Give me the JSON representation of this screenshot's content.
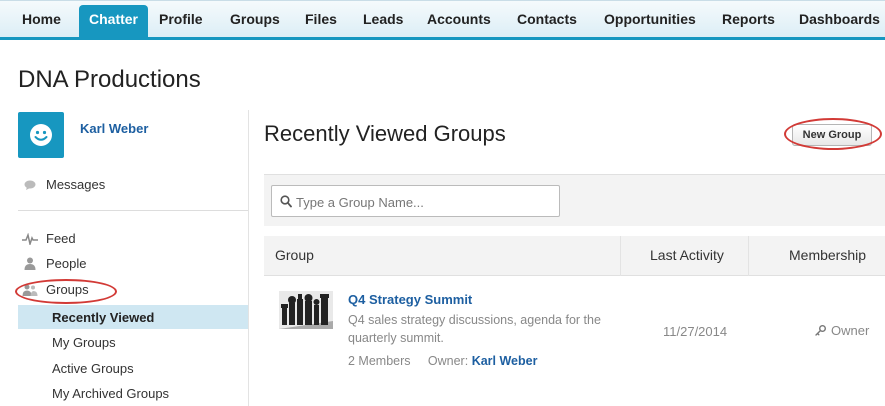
{
  "nav": {
    "tabs": [
      {
        "label": "Home"
      },
      {
        "label": "Chatter",
        "active": true
      },
      {
        "label": "Profile"
      },
      {
        "label": "Groups"
      },
      {
        "label": "Files"
      },
      {
        "label": "Leads"
      },
      {
        "label": "Accounts"
      },
      {
        "label": "Contacts"
      },
      {
        "label": "Opportunities"
      },
      {
        "label": "Reports"
      },
      {
        "label": "Dashboards"
      }
    ]
  },
  "org": {
    "title": "DNA Productions"
  },
  "sidebar": {
    "user_name": "Karl Weber",
    "messages_label": "Messages",
    "feed_label": "Feed",
    "people_label": "People",
    "groups_label": "Groups",
    "group_links": [
      {
        "label": "Recently Viewed",
        "active": true
      },
      {
        "label": "My Groups"
      },
      {
        "label": "Active Groups"
      },
      {
        "label": "My Archived Groups"
      }
    ]
  },
  "main": {
    "title": "Recently Viewed Groups",
    "new_group_label": "New Group",
    "search_placeholder": "Type a Group Name...",
    "columns": [
      "Group",
      "Last Activity",
      "Membership"
    ],
    "rows": [
      {
        "name": "Q4 Strategy Summit",
        "description": "Q4 sales strategy discussions, agenda for the quarterly summit.",
        "members": "2 Members",
        "owner_label": "Owner:",
        "owner_name": "Karl Weber",
        "last_activity": "11/27/2014",
        "membership": "Owner"
      }
    ]
  },
  "colors": {
    "brand": "#1797c0",
    "link": "#1d5fa1",
    "annotation": "#d23a36",
    "active_row": "#cfe7f2"
  },
  "icons": [
    "smiley-avatar",
    "chat-bubble-icon",
    "feed-pulse-icon",
    "person-icon",
    "people-group-icon",
    "search-icon",
    "key-icon",
    "chess-pieces-image"
  ]
}
